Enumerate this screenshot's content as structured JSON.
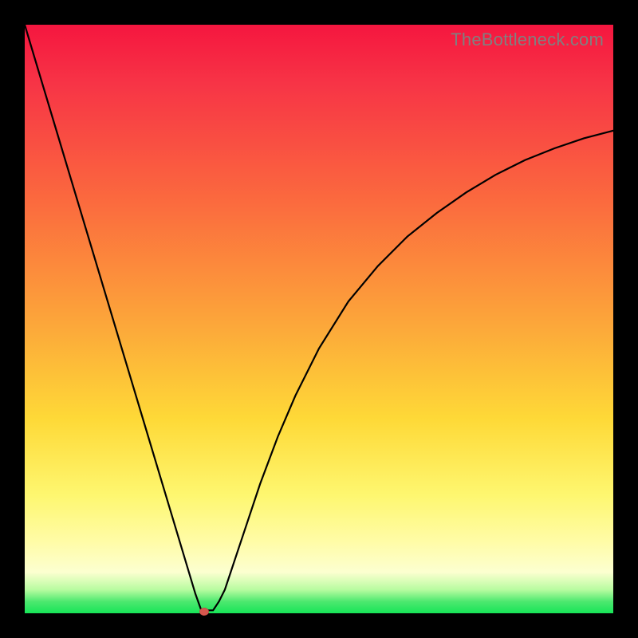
{
  "watermark": "TheBottleneck.com",
  "chart_data": {
    "type": "line",
    "title": "",
    "xlabel": "",
    "ylabel": "",
    "xlim": [
      0,
      100
    ],
    "ylim": [
      0,
      100
    ],
    "series": [
      {
        "name": "bottleneck-curve",
        "x": [
          0,
          2,
          5,
          8,
          11,
          14,
          17,
          20,
          23,
          26,
          29,
          30,
          31,
          32,
          33,
          34,
          35,
          36,
          37,
          38,
          40,
          43,
          46,
          50,
          55,
          60,
          65,
          70,
          75,
          80,
          85,
          90,
          95,
          100
        ],
        "y": [
          100,
          93.3,
          83.3,
          73.3,
          63.3,
          53.3,
          43.3,
          33.3,
          23.3,
          13.3,
          3.3,
          0.5,
          0.5,
          0.5,
          2,
          4,
          7,
          10,
          13,
          16,
          22,
          30,
          37,
          45,
          53,
          59,
          64,
          68,
          71.5,
          74.5,
          77,
          79,
          80.7,
          82
        ]
      }
    ],
    "marker": {
      "x": 30.5,
      "y": 0,
      "color": "#d6574e"
    },
    "background_gradient": {
      "top": "#f5163f",
      "mid_high": "#fca43a",
      "mid_low": "#fef770",
      "bottom": "#17e558"
    }
  }
}
